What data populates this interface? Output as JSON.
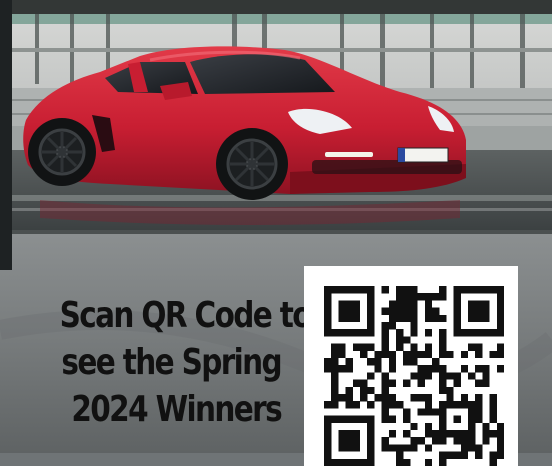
{
  "headline": {
    "lines": [
      "Scan QR Code to",
      "see the Spring",
      "2024 Winners"
    ]
  },
  "colors": {
    "car_red": "#c81e32",
    "headline_text": "#111111",
    "qr_background": "#ffffff",
    "qr_modules": "#111111"
  },
  "icons": {
    "qr": "qr-code-icon"
  }
}
